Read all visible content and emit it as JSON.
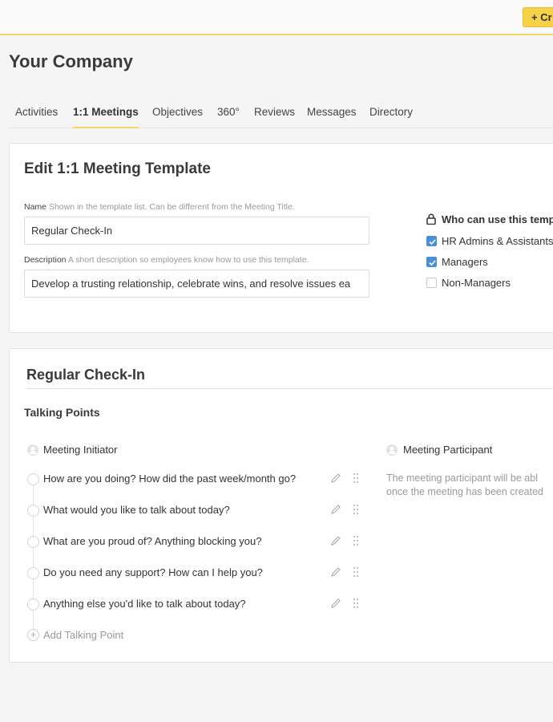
{
  "header": {
    "create_label": "+ Cr"
  },
  "company": "Your Company",
  "tabs": [
    {
      "label": "Activities"
    },
    {
      "label": "1:1 Meetings",
      "active": true
    },
    {
      "label": "Objectives"
    },
    {
      "label": "360°"
    },
    {
      "label": "Reviews"
    },
    {
      "label": "Messages"
    },
    {
      "label": "Directory"
    }
  ],
  "edit_template": {
    "title": "Edit 1:1 Meeting Template",
    "name_label": "Name",
    "name_hint": "Shown in the template list. Can be different from the Meeting Title.",
    "name_value": "Regular Check-In",
    "description_label": "Description",
    "description_hint": "A short description so employees know how to use this template.",
    "description_value": "Develop a trusting relationship, celebrate wins, and resolve issues ea",
    "who_title": "Who can use this temp",
    "options": [
      {
        "label": "HR Admins & Assistants",
        "checked": true
      },
      {
        "label": "Managers",
        "checked": true
      },
      {
        "label": "Non-Managers",
        "checked": false
      }
    ]
  },
  "template": {
    "title": "Regular Check-In",
    "talking_points_title": "Talking Points",
    "initiator_label": "Meeting Initiator",
    "participant_label": "Meeting Participant",
    "participant_note_line1": "The meeting participant will be abl",
    "participant_note_line2": "once the meeting has been created",
    "items": [
      "How are you doing? How did the past week/month go?",
      "What would you like to talk about today?",
      "What are you proud of? Anything blocking you?",
      "Do you need any support? How can I help you?",
      "Anything else you'd like to talk about today?"
    ],
    "add_label": "Add Talking Point"
  },
  "colors": {
    "accent_yellow": "#f6d24a",
    "checkbox_blue": "#4a90d9"
  }
}
